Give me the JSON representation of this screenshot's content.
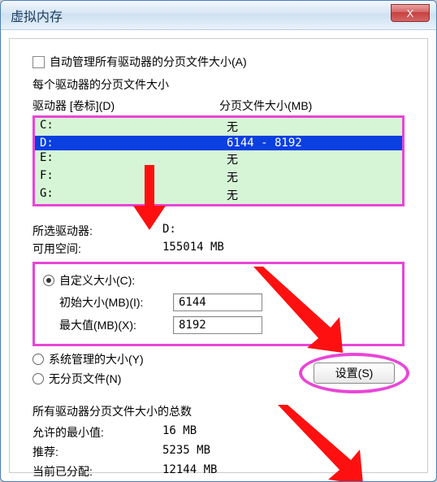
{
  "window": {
    "title": "虚拟内存"
  },
  "auto_manage_label": "自动管理所有驱动器的分页文件大小(A)",
  "per_drive_label": "每个驱动器的分页文件大小",
  "columns": {
    "drive": "驱动器 [卷标](D)",
    "page": "分页文件大小(MB)"
  },
  "drives": [
    {
      "letter": "C:",
      "page": "无"
    },
    {
      "letter": "D:",
      "page": "6144 - 8192",
      "selected": true
    },
    {
      "letter": "E:",
      "page": "无"
    },
    {
      "letter": "F:",
      "page": "无"
    },
    {
      "letter": "G:",
      "page": "无"
    }
  ],
  "selected_drive_label": "所选驱动器:",
  "selected_drive_value": "D:",
  "free_space_label": "可用空间:",
  "free_space_value": "155014 MB",
  "custom_size_label": "自定义大小(C):",
  "initial_label": "初始大小(MB)(I):",
  "initial_value": "6144",
  "max_label": "最大值(MB)(X):",
  "max_value": "8192",
  "system_managed_label": "系统管理的大小(Y)",
  "no_paging_label": "无分页文件(N)",
  "set_button": "设置(S)",
  "totals_header": "所有驱动器分页文件大小的总数",
  "totals": {
    "min_label": "允许的最小值:",
    "min_value": "16 MB",
    "rec_label": "推荐:",
    "rec_value": "5235 MB",
    "cur_label": "当前已分配:",
    "cur_value": "12144 MB"
  },
  "close_glyph": "X"
}
